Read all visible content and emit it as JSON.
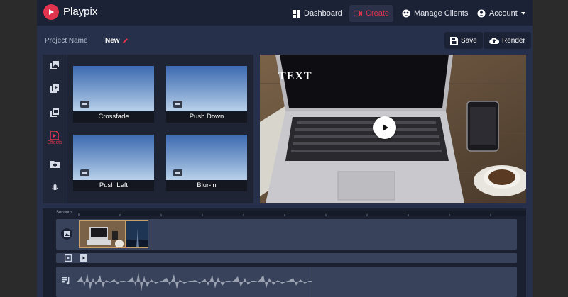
{
  "app": {
    "brand": "Playpix"
  },
  "nav": {
    "dashboard": "Dashboard",
    "create": "Create",
    "manage_clients": "Manage Clients",
    "account": "Account"
  },
  "project": {
    "label": "Project Name",
    "name": "New",
    "save": "Save",
    "render": "Render"
  },
  "tools": [
    {
      "icon": "photo-library-icon",
      "label": ""
    },
    {
      "icon": "video-library-icon",
      "label": ""
    },
    {
      "icon": "image-library-icon",
      "label": ""
    },
    {
      "icon": "effects-icon",
      "label": "Effects",
      "active": true
    },
    {
      "icon": "upload-folder-icon",
      "label": ""
    },
    {
      "icon": "microphone-icon",
      "label": ""
    }
  ],
  "effects": [
    {
      "label": "Crossfade"
    },
    {
      "label": "Push Down"
    },
    {
      "label": "Push Left"
    },
    {
      "label": "Blur-in"
    }
  ],
  "preview": {
    "overlay_text": "TEXT"
  },
  "timeline": {
    "seconds_label": "Seconds"
  },
  "colors": {
    "accent": "#e0344e",
    "navbar": "#1b2235",
    "background": "#27304a"
  }
}
